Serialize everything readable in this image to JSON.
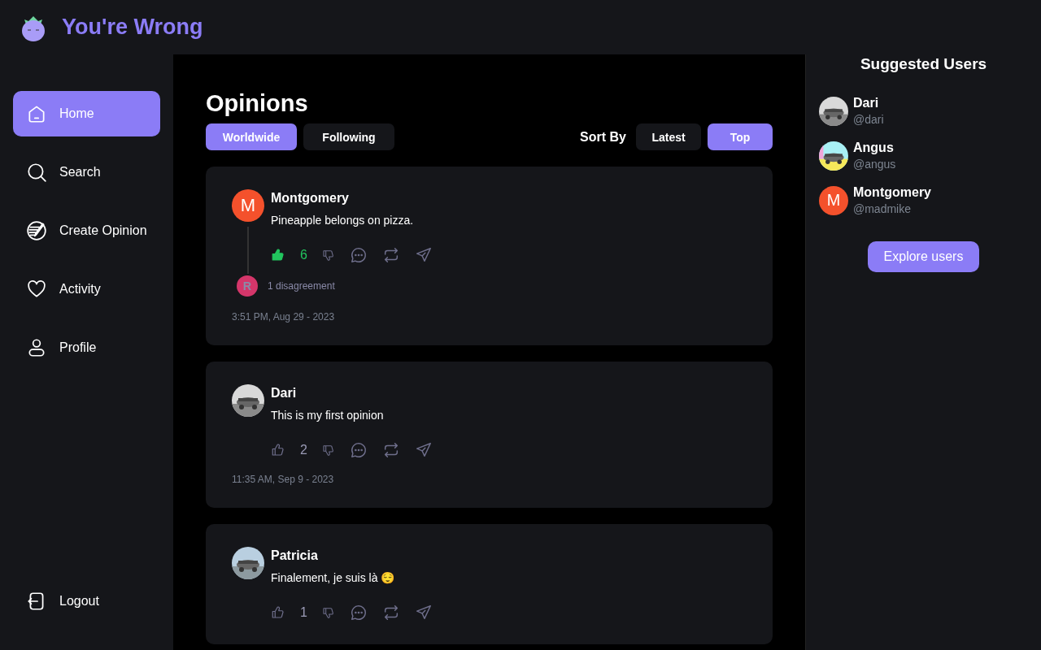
{
  "app": {
    "title": "You're Wrong"
  },
  "nav": [
    {
      "label": "Home",
      "kind": "home",
      "selected": true
    },
    {
      "label": "Search",
      "kind": "search",
      "selected": false
    },
    {
      "label": "Create Opinion",
      "kind": "create",
      "selected": false
    },
    {
      "label": "Activity",
      "kind": "activity",
      "selected": false
    },
    {
      "label": "Profile",
      "kind": "profile",
      "selected": false
    }
  ],
  "logout": {
    "label": "Logout"
  },
  "feed": {
    "title": "Opinions",
    "filters": [
      {
        "label": "Worldwide",
        "selected": true
      },
      {
        "label": "Following",
        "selected": false
      }
    ],
    "sort_label": "Sort By",
    "sorts": [
      {
        "label": "Latest",
        "selected": false
      },
      {
        "label": "Top",
        "selected": true
      }
    ],
    "posts": [
      {
        "author": "Montgomery",
        "avatar": {
          "kind": "letter",
          "letter": "M",
          "color": "#f4512c"
        },
        "text": "Pineapple belongs on pizza.",
        "liked": true,
        "likes": "6",
        "replies": {
          "letter": "R",
          "color": "#d4366a",
          "label": "1 disagreement"
        },
        "time": "3:51 PM, Aug 29 - 2023"
      },
      {
        "author": "Dari",
        "text": "This is my first opinion",
        "liked": false,
        "likes": "2",
        "time": "11:35 AM, Sep 9 - 2023"
      },
      {
        "author": "Patricia",
        "text": "Finalement, je suis là 😌",
        "liked": false,
        "likes": "1"
      }
    ]
  },
  "suggested": {
    "title": "Suggested Users",
    "users": [
      {
        "name": "Dari",
        "handle": "@dari"
      },
      {
        "name": "Angus",
        "handle": "@angus"
      },
      {
        "name": "Montgomery",
        "handle": "@madmike",
        "avatar": {
          "kind": "letter",
          "letter": "M",
          "color": "#f4512c"
        }
      }
    ],
    "button": "Explore users"
  }
}
